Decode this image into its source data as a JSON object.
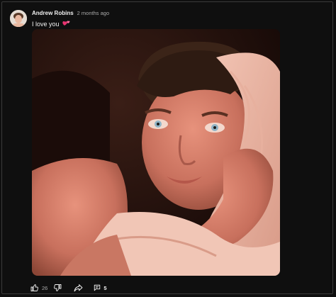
{
  "post": {
    "author": "Andrew Robins",
    "time": "2 months ago",
    "text": "I love you",
    "text_emoji_icon": "two-hearts-icon",
    "image_icon": "selfie-photo",
    "likes": "26",
    "comments": "5"
  },
  "icons": {
    "like": "thumbs-up-icon",
    "dislike": "thumbs-down-icon",
    "share": "share-icon",
    "comment": "comment-icon"
  },
  "colors": {
    "background": "#0f0f0f",
    "border": "#3a3a3a",
    "text_primary": "#f1f1f1",
    "text_secondary": "#aaaaaa",
    "heart": "#e8336f"
  }
}
